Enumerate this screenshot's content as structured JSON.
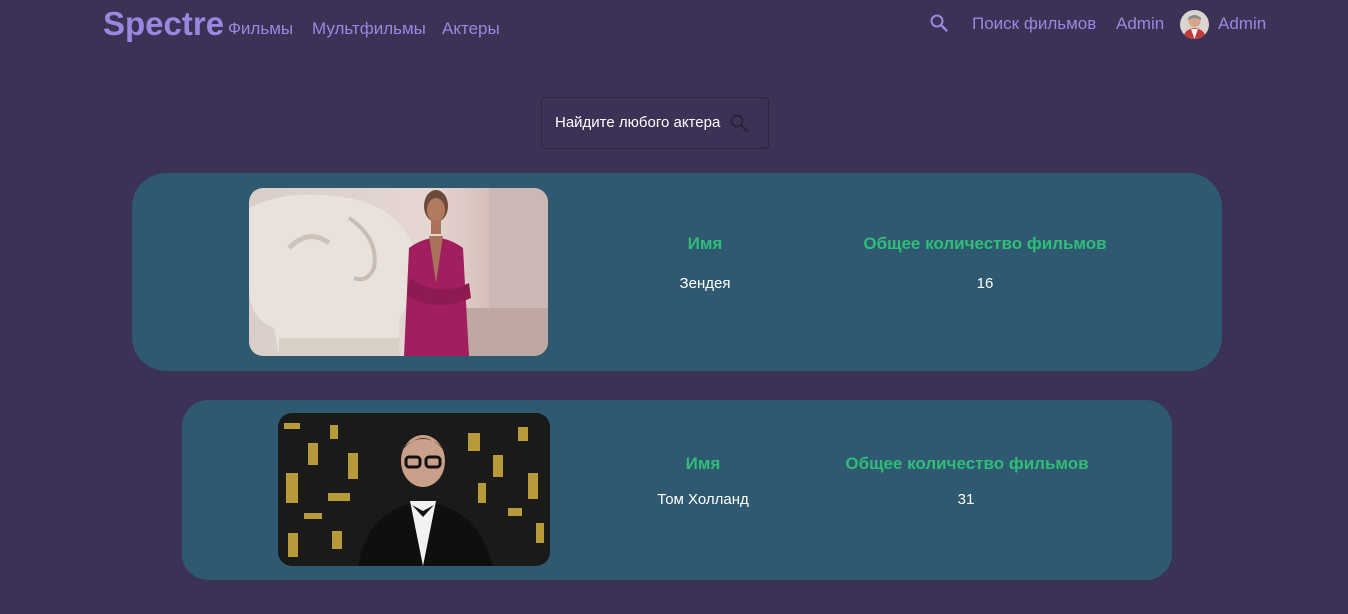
{
  "nav": {
    "logo": "Spectre",
    "links": [
      "Фильмы",
      "Мультфильмы",
      "Актеры"
    ],
    "search_label": "Поиск фильмов",
    "admin_link": "Admin",
    "user_name": "Admin",
    "search_icon": "search-icon"
  },
  "search": {
    "placeholder": "Найдите любого актера",
    "icon": "search-icon"
  },
  "actors": [
    {
      "name_header": "Имя",
      "count_header": "Общее количество фильмов",
      "name": "Зендея",
      "count": "16"
    },
    {
      "name_header": "Имя",
      "count_header": "Общее количество фильмов",
      "name": "Том Холланд",
      "count": "31"
    }
  ],
  "colors": {
    "background": "#3c3256",
    "accent": "#9b86e0",
    "card": "#2e5970",
    "header_green": "#2fbd78",
    "text": "#ffffff"
  }
}
